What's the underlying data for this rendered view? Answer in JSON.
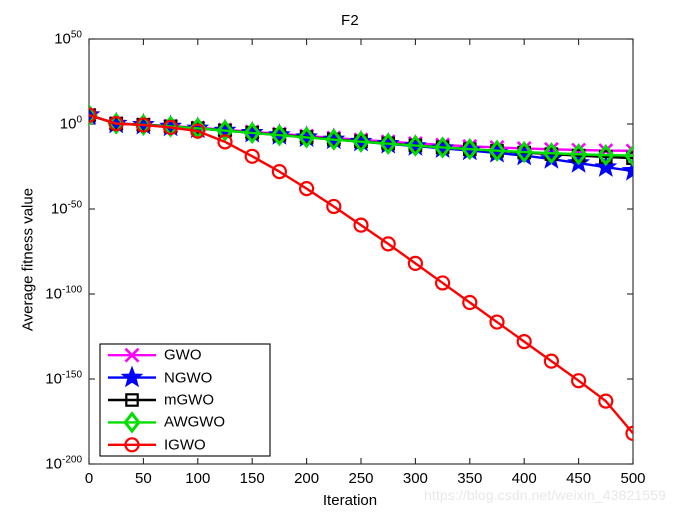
{
  "chart_data": {
    "type": "line",
    "title": "F2",
    "xlabel": "Iteration",
    "ylabel": "Average fitness value",
    "xlim": [
      0,
      500
    ],
    "ylim_log10": [
      -200,
      50
    ],
    "yscale": "log",
    "grid": false,
    "legend_position": "lower-left",
    "watermark": "https://blog.csdn.net/weixin_43821559",
    "xticks": [
      0,
      50,
      100,
      150,
      200,
      250,
      300,
      350,
      400,
      450,
      500
    ],
    "xtick_labels": [
      "0",
      "50",
      "100",
      "150",
      "200",
      "250",
      "300",
      "350",
      "400",
      "450",
      "500"
    ],
    "ytick_exponents": [
      50,
      0,
      -50,
      -100,
      -150,
      -200
    ],
    "ytick_labels": [
      "10^50",
      "10^0",
      "10^-50",
      "10^-100",
      "10^-150",
      "10^-200"
    ],
    "marker_interval": 25,
    "x": [
      0,
      25,
      50,
      75,
      100,
      125,
      150,
      175,
      200,
      225,
      250,
      275,
      300,
      325,
      350,
      375,
      400,
      425,
      450,
      475,
      500
    ],
    "series": [
      {
        "name": "GWO",
        "color": "#ff00ff",
        "marker": "x",
        "marker_label": "cross-marker",
        "values_log10": [
          5.2,
          0.3,
          -0.3,
          -1.2,
          -2.2,
          -3.4,
          -4.6,
          -5.8,
          -7.0,
          -8.2,
          -9.3,
          -10.4,
          -11.4,
          -12.3,
          -13.1,
          -13.8,
          -14.4,
          -14.9,
          -15.3,
          -15.6,
          -15.8
        ]
      },
      {
        "name": "NGWO",
        "color": "#0000ff",
        "marker": "star",
        "marker_label": "star-marker",
        "values_log10": [
          5.2,
          0.2,
          -0.5,
          -1.5,
          -2.6,
          -3.9,
          -5.2,
          -6.5,
          -7.8,
          -9.1,
          -10.4,
          -11.7,
          -13.0,
          -14.3,
          -15.6,
          -17.0,
          -18.6,
          -20.6,
          -23.0,
          -25.4,
          -27.6
        ]
      },
      {
        "name": "mGWO",
        "color": "#000000",
        "marker": "square",
        "marker_label": "square-marker",
        "values_log10": [
          5.2,
          0.25,
          -0.45,
          -1.4,
          -2.5,
          -3.8,
          -5.1,
          -6.4,
          -7.7,
          -9.0,
          -10.2,
          -11.4,
          -12.6,
          -13.7,
          -14.8,
          -15.8,
          -16.8,
          -17.7,
          -18.6,
          -19.4,
          -20.1
        ]
      },
      {
        "name": "AWGWO",
        "color": "#00dd00",
        "marker": "diamond",
        "marker_label": "diamond-marker",
        "values_log10": [
          5.2,
          0.22,
          -0.5,
          -1.45,
          -2.55,
          -3.9,
          -5.25,
          -6.6,
          -7.9,
          -9.2,
          -10.4,
          -11.6,
          -12.7,
          -13.8,
          -14.8,
          -15.7,
          -16.5,
          -17.2,
          -17.8,
          -18.3,
          -18.6
        ]
      },
      {
        "name": "IGWO",
        "color": "#ff0000",
        "marker": "circle",
        "marker_label": "circle-marker",
        "values_log10": [
          5.2,
          0.2,
          -0.6,
          -2.0,
          -4.2,
          -10.5,
          -19.0,
          -28.0,
          -38.0,
          -48.5,
          -59.5,
          -70.5,
          -82.0,
          -93.5,
          -105.0,
          -116.5,
          -128.0,
          -139.5,
          -151.0,
          -163.0,
          -182.0
        ]
      }
    ]
  },
  "legend": {
    "items": [
      {
        "label": "GWO"
      },
      {
        "label": "NGWO"
      },
      {
        "label": "mGWO"
      },
      {
        "label": "AWGWO"
      },
      {
        "label": "IGWO"
      }
    ]
  }
}
